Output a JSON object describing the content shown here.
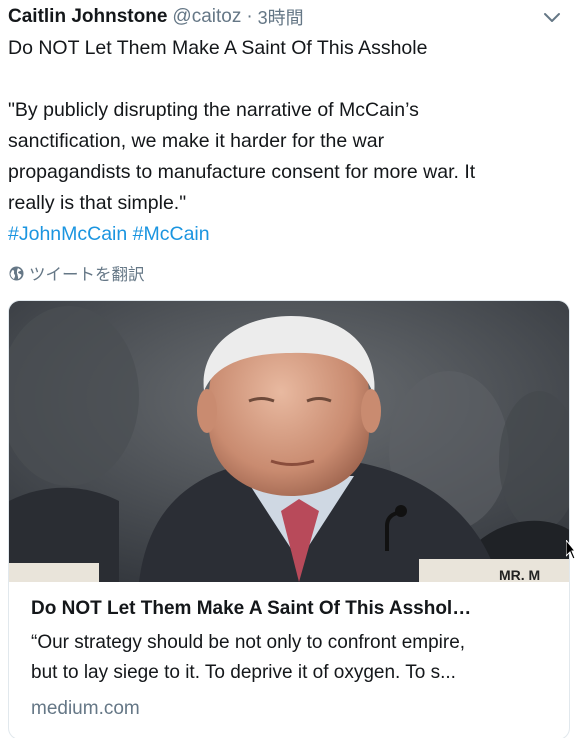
{
  "tweet": {
    "author_name": "Caitlin Johnstone",
    "handle": "@caitoz",
    "separator": "·",
    "time": "3時間",
    "text_lines": [
      "Do NOT Let Them Make A Saint Of This Asshole",
      "\"By publicly disrupting the narrative of McCain’s",
      "sanctification, we make it harder for the war",
      "propagandists to manufacture consent for more war. It",
      "really is that simple.\""
    ],
    "hashtags": [
      "#JohnMcCain",
      "#McCain"
    ],
    "translate_label": "ツイートを翻訳"
  },
  "card": {
    "title": "Do NOT Let Them Make A Saint Of This Asshol…",
    "description_lines": [
      "“Our strategy should be not only to confront empire,",
      "but to lay siege to it. To deprive it of oxygen. To s..."
    ],
    "domain": "medium.com",
    "nameplate_text": "MR. M"
  },
  "icons": {
    "more": "chevron-down-icon",
    "translate": "globe-icon"
  },
  "colors": {
    "link": "#1b95e0",
    "secondary": "#657786",
    "text": "#14171a",
    "border": "#e1e8ed"
  }
}
